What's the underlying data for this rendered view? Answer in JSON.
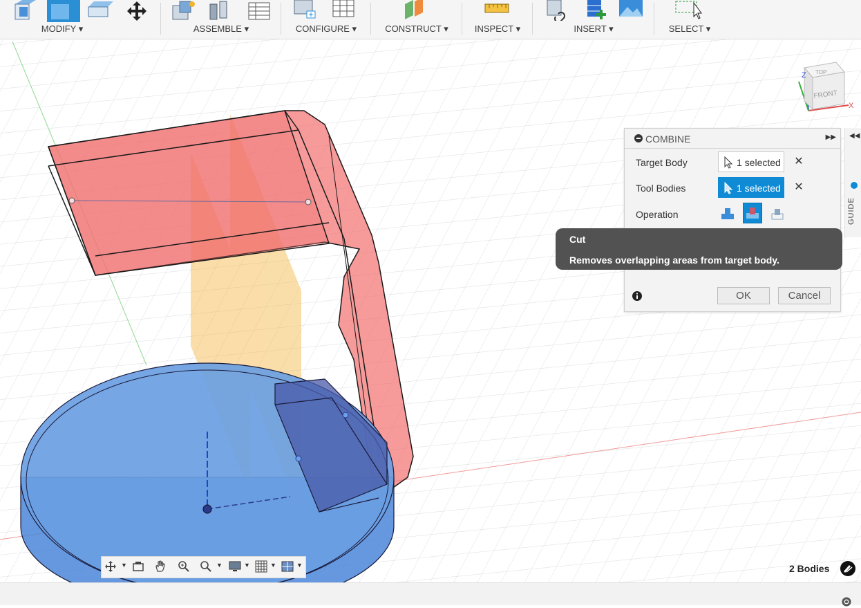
{
  "toolbar": {
    "groups": [
      {
        "label": "MODIFY ▾"
      },
      {
        "label": "ASSEMBLE ▾"
      },
      {
        "label": "CONFIGURE ▾"
      },
      {
        "label": "CONSTRUCT ▾"
      },
      {
        "label": "INSPECT ▾"
      },
      {
        "label": "INSERT ▾"
      },
      {
        "label": "SELECT ▾"
      }
    ]
  },
  "viewcube": {
    "top": "TOP",
    "front": "FRONT",
    "axis_z": "Z",
    "axis_x": "X"
  },
  "combine_panel": {
    "title": "COMBINE",
    "target_body_label": "Target Body",
    "target_body_value": "1 selected",
    "tool_bodies_label": "Tool Bodies",
    "tool_bodies_value": "1 selected",
    "operation_label": "Operation",
    "ok_label": "OK",
    "cancel_label": "Cancel"
  },
  "tooltip": {
    "title": "Cut",
    "description": "Removes overlapping areas from target body."
  },
  "guide_tab": {
    "label": "GUIDE"
  },
  "status": {
    "bodies_count": "2 Bodies"
  },
  "colors": {
    "accent": "#0f8bd6",
    "tool_body": "#f26f6f",
    "target_body": "#4a86d8",
    "construction_plane": "#f5b642",
    "tooltip_bg": "#525252"
  }
}
